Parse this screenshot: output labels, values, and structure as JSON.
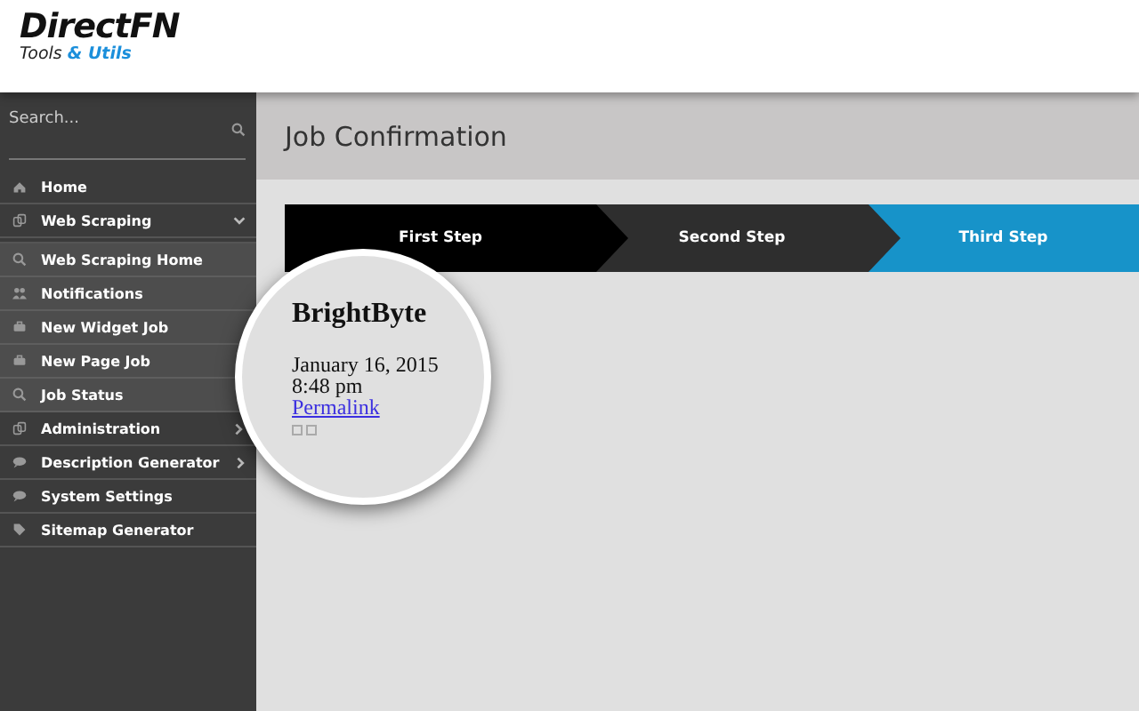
{
  "logo": {
    "title": "DirectFN",
    "subtitle": "Tools ",
    "subtitle_accent": "& Utils"
  },
  "sidebar": {
    "search": {
      "placeholder": "Search..."
    },
    "items": [
      {
        "label": "Home"
      },
      {
        "label": "Web Scraping",
        "expanded": true,
        "children": [
          {
            "label": "Web Scraping Home"
          },
          {
            "label": "Notifications"
          },
          {
            "label": "New Widget Job"
          },
          {
            "label": "New Page Job"
          },
          {
            "label": "Job Status"
          }
        ]
      },
      {
        "label": "Administration",
        "expanded": false
      },
      {
        "label": "Description Generator",
        "expanded": false
      },
      {
        "label": "System Settings"
      },
      {
        "label": "Sitemap Generator"
      }
    ]
  },
  "page": {
    "title": "Job Confirmation"
  },
  "steps": [
    {
      "label": "First Step",
      "completed": true,
      "selected": false
    },
    {
      "label": "Second Step",
      "completed": false,
      "selected": false
    },
    {
      "label": "Third Step",
      "selected": true
    }
  ],
  "magnifier": {
    "title": "BrightByte",
    "date": "January 16, 2015",
    "time": "8:48 pm",
    "link": "Permalink"
  }
}
